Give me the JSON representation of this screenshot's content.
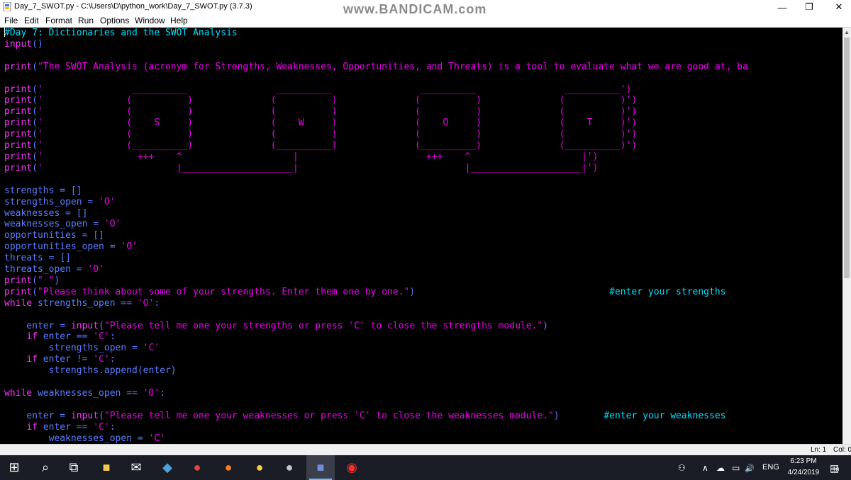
{
  "window": {
    "title": "Day_7_SWOT.py - C:\\Users\\D\\python_work\\Day_7_SWOT.py (3.7.3)",
    "watermark": "www.BANDICAM.com",
    "minimize_glyph": "—",
    "maximize_glyph": "❐",
    "close_glyph": "✕"
  },
  "menu": {
    "items": [
      "File",
      "Edit",
      "Format",
      "Run",
      "Options",
      "Window",
      "Help"
    ]
  },
  "editor": {
    "lines": [
      {
        "segs": [
          [
            "cm",
            "#Day 7: Dictionaries and the SWOT Analysis"
          ]
        ]
      },
      {
        "segs": [
          [
            "kw",
            "input"
          ],
          [
            "",
            "()"
          ]
        ]
      },
      {
        "segs": []
      },
      {
        "segs": [
          [
            "kw",
            "print"
          ],
          [
            "",
            "("
          ],
          [
            "st",
            "\"The SWOT Analysis (acronym for Strengths, Weaknesses, Opportunities, and Threats) is a tool to evaluate what we are good at, ba"
          ]
        ]
      },
      {
        "segs": []
      },
      {
        "segs": [
          [
            "kw",
            "print"
          ],
          [
            "",
            "("
          ],
          [
            "st",
            "'                __________                __________                __________                __________')"
          ]
        ]
      },
      {
        "segs": [
          [
            "kw",
            "print"
          ],
          [
            "",
            "("
          ],
          [
            "st",
            "'               (          )              (          )              (          )              (          )')"
          ]
        ]
      },
      {
        "segs": [
          [
            "kw",
            "print"
          ],
          [
            "",
            "("
          ],
          [
            "st",
            "'               (          )              (          )              (          )              (          )')"
          ]
        ]
      },
      {
        "segs": [
          [
            "kw",
            "print"
          ],
          [
            "",
            "("
          ],
          [
            "st",
            "'               (    S     )              (    W     )              (    O     )              (    T     )')"
          ]
        ]
      },
      {
        "segs": [
          [
            "kw",
            "print"
          ],
          [
            "",
            "("
          ],
          [
            "st",
            "'               (          )              (          )              (          )              (          )')"
          ]
        ]
      },
      {
        "segs": [
          [
            "kw",
            "print"
          ],
          [
            "",
            "("
          ],
          [
            "st",
            "'               (__________)              (__________)              (__________)              (__________)')"
          ]
        ]
      },
      {
        "segs": [
          [
            "kw",
            "print"
          ],
          [
            "",
            "("
          ],
          [
            "st",
            "'                 +++    ^                    |                       +++    ^                    |')"
          ]
        ]
      },
      {
        "segs": [
          [
            "kw",
            "print"
          ],
          [
            "",
            "("
          ],
          [
            "st",
            "'                        |____________________|                              |____________________|')"
          ]
        ]
      },
      {
        "segs": []
      },
      {
        "segs": [
          [
            "",
            "strengths = []"
          ]
        ]
      },
      {
        "segs": [
          [
            "",
            "strengths_open = "
          ],
          [
            "st",
            "'O'"
          ]
        ]
      },
      {
        "segs": [
          [
            "",
            "weaknesses = []"
          ]
        ]
      },
      {
        "segs": [
          [
            "",
            "weaknesses_open = "
          ],
          [
            "st",
            "'O'"
          ]
        ]
      },
      {
        "segs": [
          [
            "",
            "opportunities = []"
          ]
        ]
      },
      {
        "segs": [
          [
            "",
            "opportunities_open = "
          ],
          [
            "st",
            "'O'"
          ]
        ]
      },
      {
        "segs": [
          [
            "",
            "threats = []"
          ]
        ]
      },
      {
        "segs": [
          [
            "",
            "threats_open = "
          ],
          [
            "st",
            "'O'"
          ]
        ]
      },
      {
        "segs": [
          [
            "kw",
            "print"
          ],
          [
            "",
            "("
          ],
          [
            "st",
            "\" \""
          ],
          [
            "",
            ")"
          ]
        ]
      },
      {
        "segs": [
          [
            "kw",
            "print"
          ],
          [
            "",
            "("
          ],
          [
            "st",
            "\"Please think about some of your strengths. Enter them one by one.\""
          ],
          [
            "",
            ")                                   "
          ],
          [
            "cm",
            "#enter your strengths"
          ]
        ]
      },
      {
        "segs": [
          [
            "kw",
            "while"
          ],
          [
            "",
            " strengths_open == "
          ],
          [
            "st",
            "'O'"
          ],
          [
            "",
            ":"
          ]
        ]
      },
      {
        "segs": []
      },
      {
        "segs": [
          [
            "",
            "    enter = "
          ],
          [
            "kw",
            "input"
          ],
          [
            "",
            "("
          ],
          [
            "st",
            "\"Please tell me one your strengths or press 'C' to close the strengths module.\""
          ],
          [
            "",
            ")"
          ]
        ]
      },
      {
        "segs": [
          [
            "",
            "    "
          ],
          [
            "kw",
            "if"
          ],
          [
            "",
            " enter == "
          ],
          [
            "st",
            "'C'"
          ],
          [
            "",
            ":"
          ]
        ]
      },
      {
        "segs": [
          [
            "",
            "        strengths_open = "
          ],
          [
            "st",
            "'C'"
          ]
        ]
      },
      {
        "segs": [
          [
            "",
            "    "
          ],
          [
            "kw",
            "if"
          ],
          [
            "",
            " enter != "
          ],
          [
            "st",
            "'C'"
          ],
          [
            "",
            ":"
          ]
        ]
      },
      {
        "segs": [
          [
            "",
            "        strengths.append(enter)"
          ]
        ]
      },
      {
        "segs": []
      },
      {
        "segs": [
          [
            "kw",
            "while"
          ],
          [
            "",
            " weaknesses_open == "
          ],
          [
            "st",
            "'O'"
          ],
          [
            "",
            ":"
          ]
        ]
      },
      {
        "segs": []
      },
      {
        "segs": [
          [
            "",
            "    enter = "
          ],
          [
            "kw",
            "input"
          ],
          [
            "",
            "("
          ],
          [
            "st",
            "\"Please tell me one your weaknesses or press 'C' to close the weaknesses module.\""
          ],
          [
            "",
            ")        "
          ],
          [
            "cm",
            "#enter your weaknesses"
          ]
        ]
      },
      {
        "segs": [
          [
            "",
            "    "
          ],
          [
            "kw",
            "if"
          ],
          [
            "",
            " enter == "
          ],
          [
            "st",
            "'C'"
          ],
          [
            "",
            ":"
          ]
        ]
      },
      {
        "segs": [
          [
            "",
            "        weaknesses_open = "
          ],
          [
            "st",
            "'C'"
          ]
        ]
      }
    ]
  },
  "status": {
    "line": "Ln: 1",
    "col": "Col: 0"
  },
  "taskbar": {
    "apps": [
      {
        "name": "start-button",
        "glyph": "⊞",
        "color": "#ffffff",
        "active": false
      },
      {
        "name": "search-icon",
        "glyph": "⌕",
        "color": "#ffffff",
        "active": false
      },
      {
        "name": "task-view-icon",
        "glyph": "⧉",
        "color": "#ffffff",
        "active": false
      },
      {
        "name": "file-explorer-icon",
        "glyph": "■",
        "color": "#f2c94c",
        "active": false
      },
      {
        "name": "mail-icon",
        "glyph": "✉",
        "color": "#ffffff",
        "active": false
      },
      {
        "name": "store-app-icon",
        "glyph": "◆",
        "color": "#4aa3df",
        "active": false
      },
      {
        "name": "chrome-icon",
        "glyph": "●",
        "color": "#e8453c",
        "active": false
      },
      {
        "name": "firefox-icon",
        "glyph": "●",
        "color": "#ff7b1c",
        "active": false
      },
      {
        "name": "pikachu-app-icon",
        "glyph": "●",
        "color": "#f4d03f",
        "active": false
      },
      {
        "name": "cat-app-icon",
        "glyph": "●",
        "color": "#bfc5cc",
        "active": false
      },
      {
        "name": "python-idle-icon",
        "glyph": "■",
        "color": "#6e8fd6",
        "active": true
      },
      {
        "name": "bandicam-record-icon",
        "glyph": "◉",
        "color": "#ff2d2d",
        "active": false
      }
    ],
    "tray": {
      "people_glyph": "⚇",
      "chevron_glyph": "∧",
      "cloud_glyph": "☁",
      "battery_glyph": "▭",
      "volume_glyph": "🔊",
      "language": "ENG",
      "time": "6:23 PM",
      "date": "4/24/2019",
      "notification_glyph": "▤",
      "notification_count": "10"
    }
  }
}
